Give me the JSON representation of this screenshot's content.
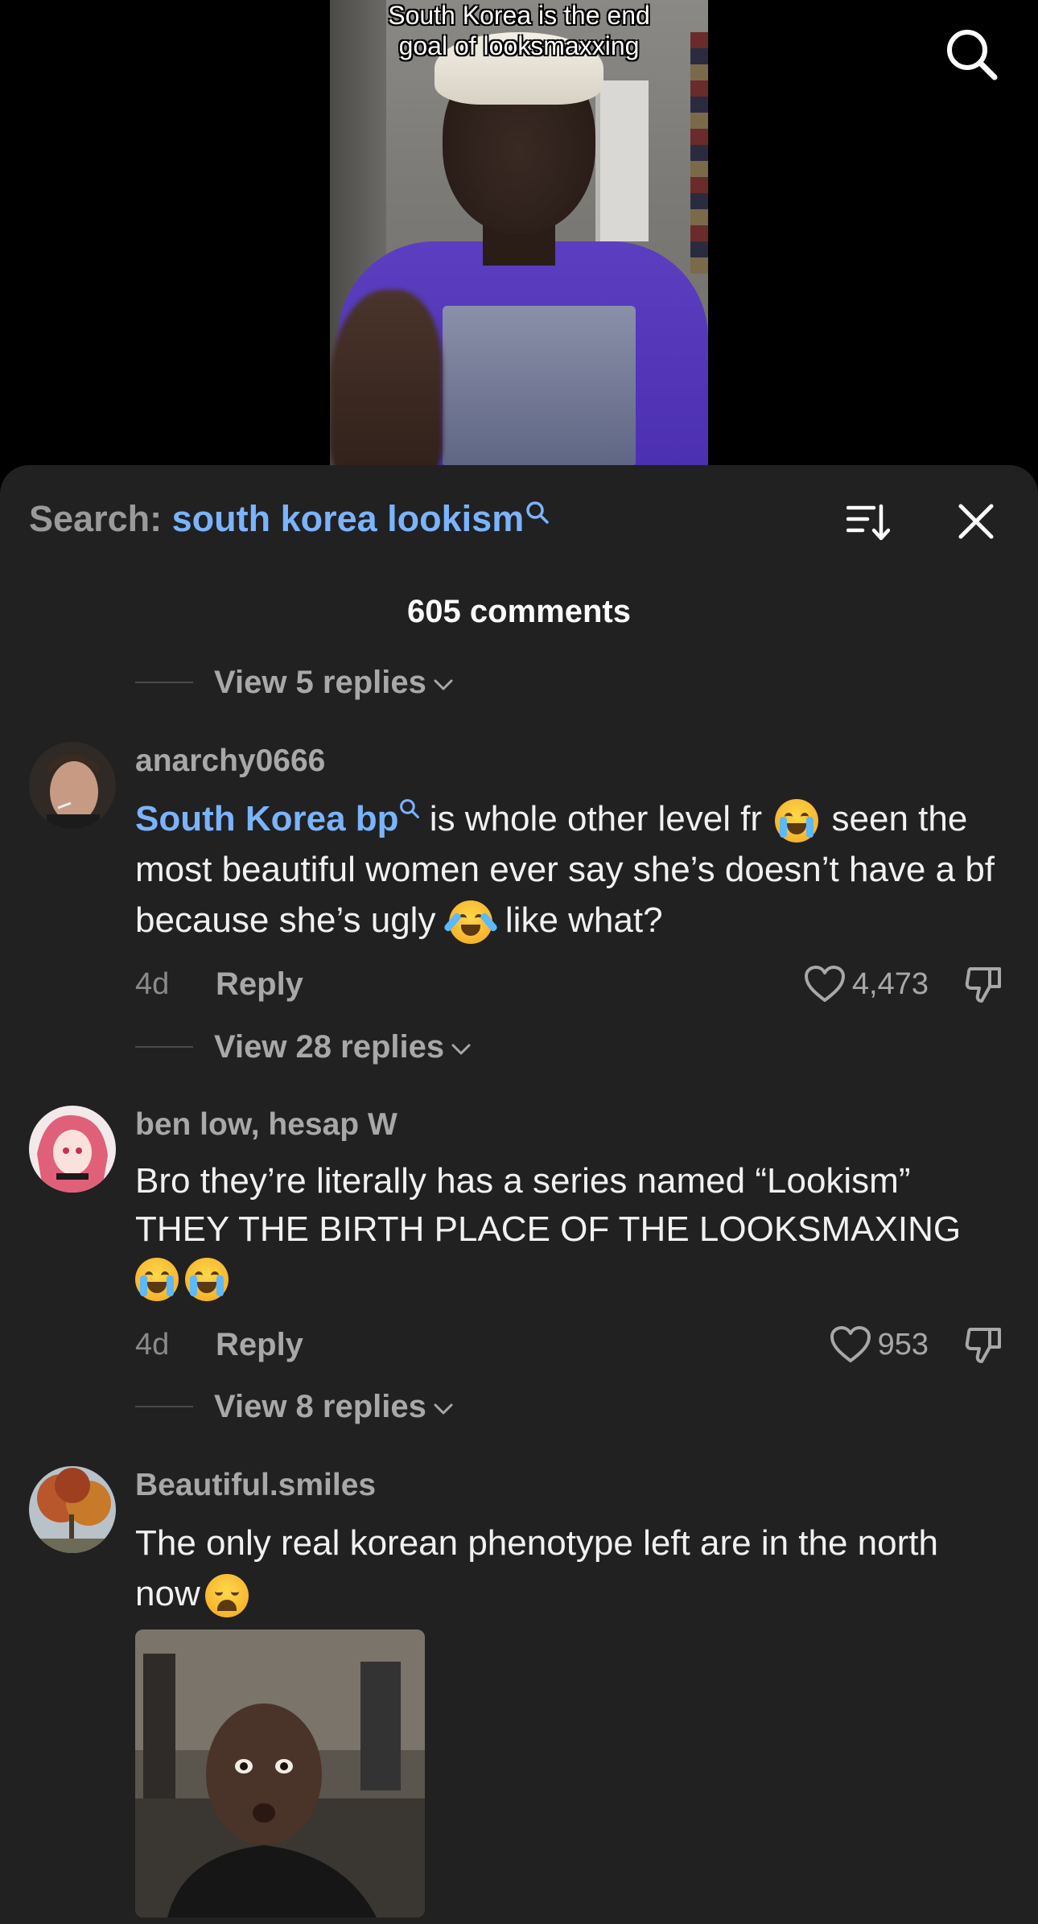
{
  "video": {
    "caption": "South Korea is the end\ngoal of looksmaxxing",
    "search_icon": "search-icon"
  },
  "sheet": {
    "search_prefix": "Search: ",
    "search_term": "south korea lookism",
    "sort_icon": "sort-icon",
    "close_icon": "close-icon",
    "comment_count": "605 comments"
  },
  "threads": [
    {
      "view_replies": "View 5 replies"
    },
    {
      "username": "anarchy0666",
      "highlight": "South Korea bp",
      "text_1": " is whole other level fr ",
      "text_2": " seen the most beautiful women ever say she’s doesn’t have a bf because she’s ugly ",
      "text_3": " like what?",
      "time": "4d",
      "reply_label": "Reply",
      "likes": "4,473",
      "view_replies": "View 28 replies"
    },
    {
      "username": "ben low, hesap W",
      "text_1": "Bro they’re literally has a series named “Lookism” THEY THE BIRTH PLACE OF THE LOOKSMAXING",
      "time": "4d",
      "reply_label": "Reply",
      "likes": "953",
      "view_replies": "View 8 replies"
    },
    {
      "username": "Beautiful.smiles",
      "text_1": "The only real korean phenotype left are in the north now",
      "has_gif": true
    }
  ],
  "colors": {
    "sheet_bg": "#212121",
    "link_blue": "#7ab3ff",
    "muted": "#a8a8a8"
  }
}
